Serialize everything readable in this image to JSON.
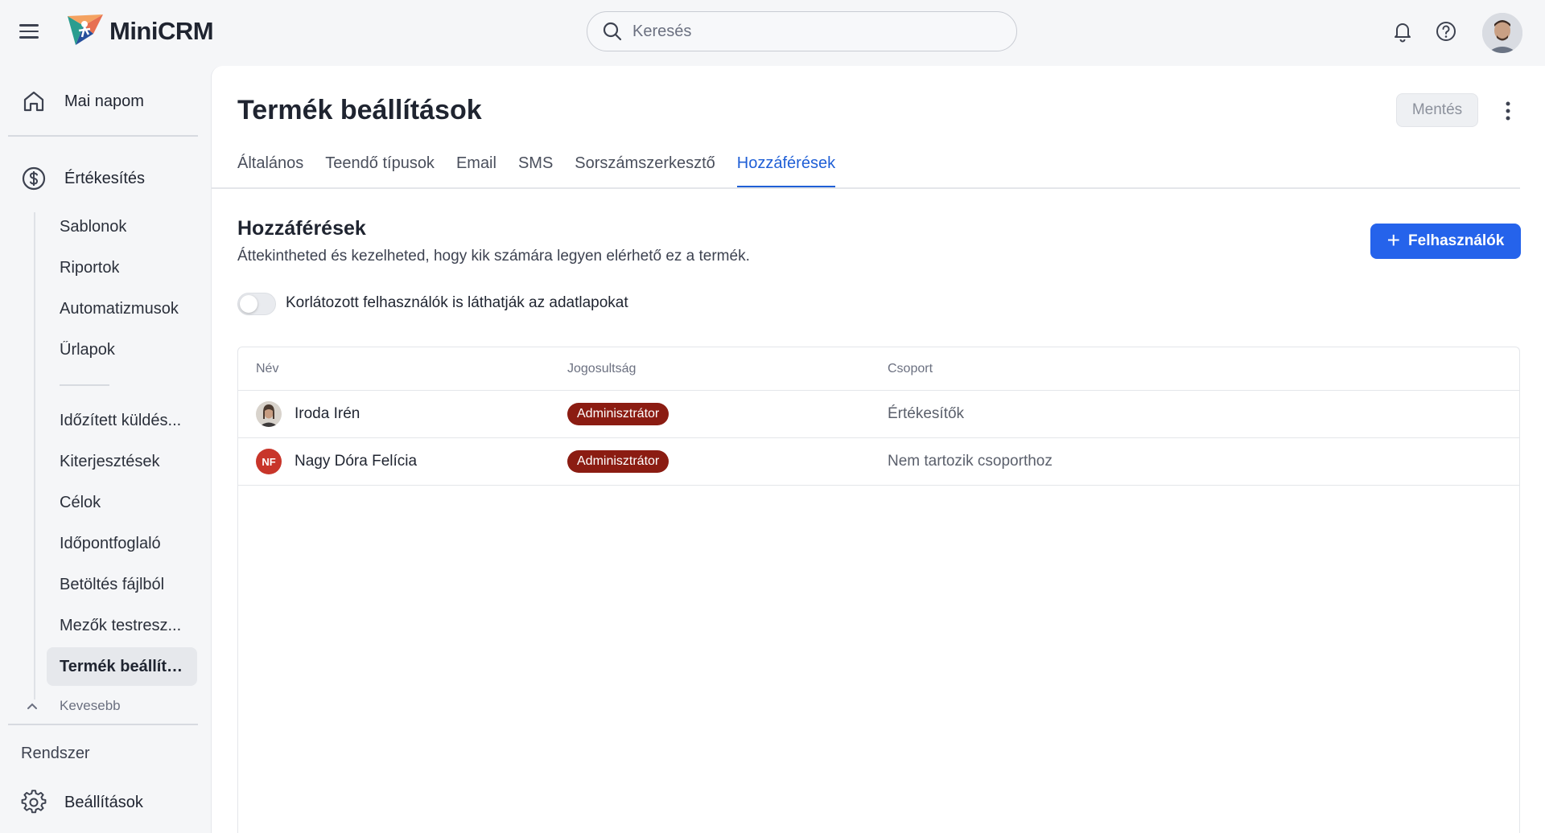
{
  "app": {
    "name": "MiniCRM"
  },
  "search": {
    "placeholder": "Keresés",
    "value": ""
  },
  "sidebar": {
    "home": "Mai napom",
    "sales": "Értékesítés",
    "items": [
      "Sablonok",
      "Riportok",
      "Automatizmusok",
      "Űrlapok",
      "Időzített küldés...",
      "Kiterjesztések",
      "Célok",
      "Időpontfoglaló",
      "Betöltés fájlból",
      "Mezők testresz...",
      "Termék beállítá..."
    ],
    "active_index": 10,
    "less": "Kevesebb",
    "section_system": "Rendszer",
    "settings": "Beállítások"
  },
  "page": {
    "title": "Termék beállítások",
    "save_label": "Mentés",
    "tabs": [
      "Általános",
      "Teendő típusok",
      "Email",
      "SMS",
      "Sorszámszerkesztő",
      "Hozzáférések"
    ],
    "active_tab": "Hozzáférések"
  },
  "access": {
    "title": "Hozzáférések",
    "description": "Áttekintheted és kezelheted, hogy kik számára legyen elérhető ez a termék.",
    "add_button": "Felhasználók",
    "toggle_label": "Korlátozott felhasználók is láthatják az adatlapokat",
    "toggle_on": false,
    "columns": [
      "Név",
      "Jogosultság",
      "Csoport"
    ],
    "rows": [
      {
        "name": "Iroda Irén",
        "avatar": "photo",
        "role": "Adminisztrátor",
        "group": "Értékesítők"
      },
      {
        "name": "Nagy Dóra Felícia",
        "avatar": "initials",
        "initials": "NF",
        "role": "Adminisztrátor",
        "group": "Nem tartozik csoporthoz"
      }
    ]
  },
  "colors": {
    "accent": "#2563eb",
    "active_tab": "#1f5fd6",
    "badge": "#8b1c12",
    "initials_bg": "#c8352a"
  }
}
